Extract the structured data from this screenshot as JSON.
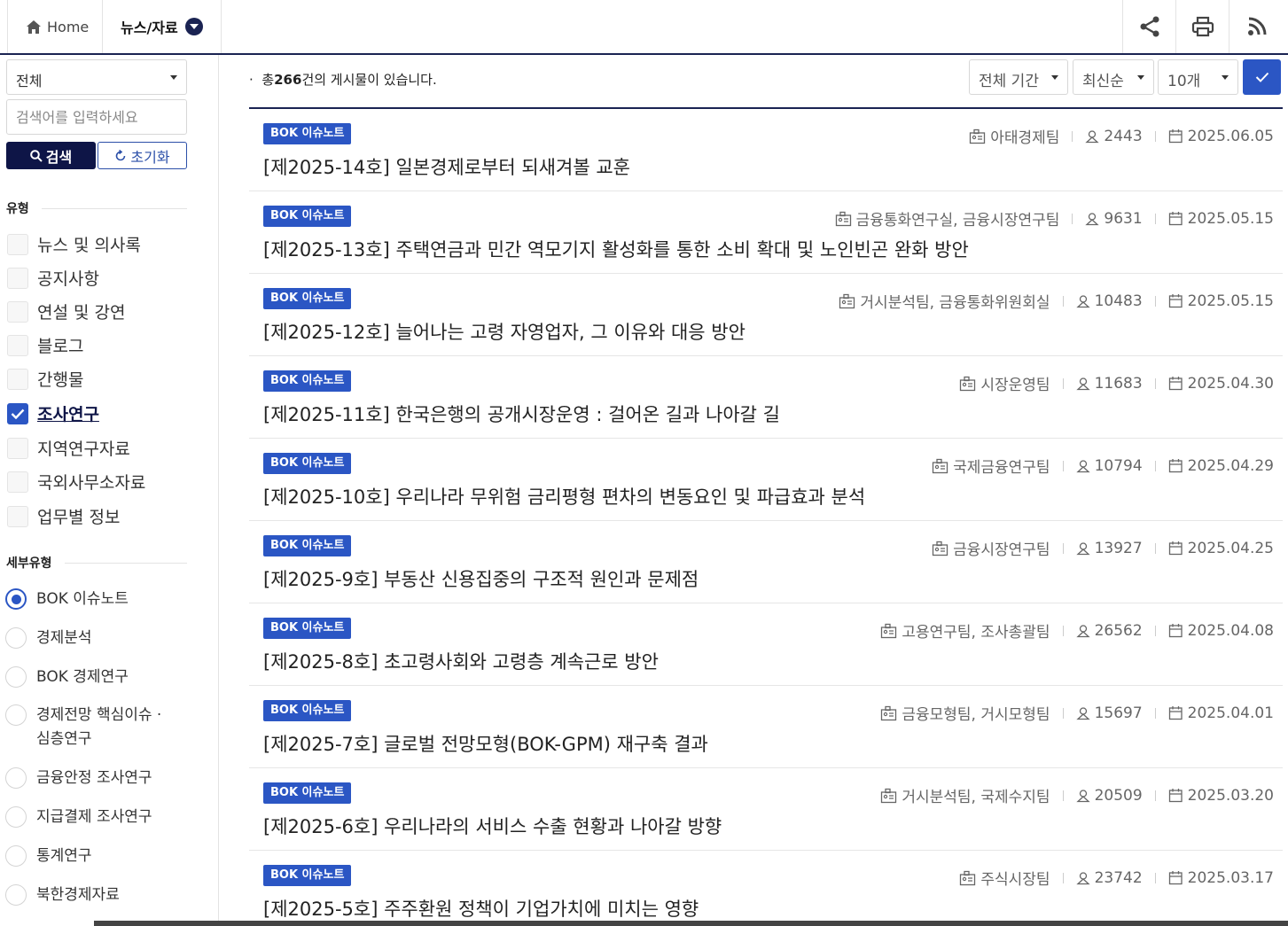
{
  "nav": {
    "home": "Home",
    "breadcrumb": "뉴스/자료",
    "tools": [
      "share-icon",
      "print-icon",
      "rss-icon"
    ]
  },
  "sidebar": {
    "category_select": "전체",
    "search_placeholder": "검색어를 입력하세요",
    "search_button": "검색",
    "reset_button": "초기화",
    "type_title": "유형",
    "types": [
      {
        "label": "뉴스 및 의사록",
        "checked": false
      },
      {
        "label": "공지사항",
        "checked": false
      },
      {
        "label": "연설 및 강연",
        "checked": false
      },
      {
        "label": "블로그",
        "checked": false
      },
      {
        "label": "간행물",
        "checked": false
      },
      {
        "label": "조사연구",
        "checked": true
      },
      {
        "label": "지역연구자료",
        "checked": false
      },
      {
        "label": "국외사무소자료",
        "checked": false
      },
      {
        "label": "업무별 정보",
        "checked": false
      }
    ],
    "subtype_title": "세부유형",
    "subtypes": [
      {
        "label": "BOK 이슈노트",
        "selected": true
      },
      {
        "label": "경제분석",
        "selected": false
      },
      {
        "label": "BOK 경제연구",
        "selected": false
      },
      {
        "label": "경제전망 핵심이슈 · 심층연구",
        "selected": false
      },
      {
        "label": "금융안정 조사연구",
        "selected": false
      },
      {
        "label": "지급결제 조사연구",
        "selected": false
      },
      {
        "label": "통계연구",
        "selected": false
      },
      {
        "label": "북한경제자료",
        "selected": false
      }
    ]
  },
  "main": {
    "count_prefix": "총",
    "count": "266",
    "count_suffix": "건의 게시물이 있습니다.",
    "period_select": "전체 기간",
    "sort_select": "최신순",
    "page_size_select": "10개",
    "accent_color": "#2b56c4",
    "navy_color": "#0e1547",
    "posts": [
      {
        "badge": "BOK 이슈노트",
        "title": "[제2025-14호] 일본경제로부터 되새겨볼 교훈",
        "dept": "아태경제팀",
        "views": "2443",
        "date": "2025.06.05"
      },
      {
        "badge": "BOK 이슈노트",
        "title": "[제2025-13호] 주택연금과 민간 역모기지 활성화를 통한 소비 확대 및 노인빈곤 완화 방안",
        "dept": "금융통화연구실, 금융시장연구팀",
        "views": "9631",
        "date": "2025.05.15"
      },
      {
        "badge": "BOK 이슈노트",
        "title": "[제2025-12호] 늘어나는 고령 자영업자, 그 이유와 대응 방안",
        "dept": "거시분석팀, 금융통화위원회실",
        "views": "10483",
        "date": "2025.05.15"
      },
      {
        "badge": "BOK 이슈노트",
        "title": "[제2025-11호] 한국은행의 공개시장운영 : 걸어온 길과 나아갈 길",
        "dept": "시장운영팀",
        "views": "11683",
        "date": "2025.04.30"
      },
      {
        "badge": "BOK 이슈노트",
        "title": "[제2025-10호] 우리나라 무위험 금리평형 편차의 변동요인 및 파급효과 분석",
        "dept": "국제금융연구팀",
        "views": "10794",
        "date": "2025.04.29"
      },
      {
        "badge": "BOK 이슈노트",
        "title": "[제2025-9호] 부동산 신용집중의 구조적 원인과 문제점",
        "dept": "금융시장연구팀",
        "views": "13927",
        "date": "2025.04.25"
      },
      {
        "badge": "BOK 이슈노트",
        "title": "[제2025-8호] 초고령사회와 고령층 계속근로 방안",
        "dept": "고용연구팀, 조사총괄팀",
        "views": "26562",
        "date": "2025.04.08"
      },
      {
        "badge": "BOK 이슈노트",
        "title": "[제2025-7호] 글로벌 전망모형(BOK-GPM) 재구축 결과",
        "dept": "금융모형팀, 거시모형팀",
        "views": "15697",
        "date": "2025.04.01"
      },
      {
        "badge": "BOK 이슈노트",
        "title": "[제2025-6호] 우리나라의 서비스 수출 현황과 나아갈 방향",
        "dept": "거시분석팀, 국제수지팀",
        "views": "20509",
        "date": "2025.03.20"
      },
      {
        "badge": "BOK 이슈노트",
        "title": "[제2025-5호] 주주환원 정책이 기업가치에 미치는 영향",
        "dept": "주식시장팀",
        "views": "23742",
        "date": "2025.03.17"
      }
    ]
  }
}
